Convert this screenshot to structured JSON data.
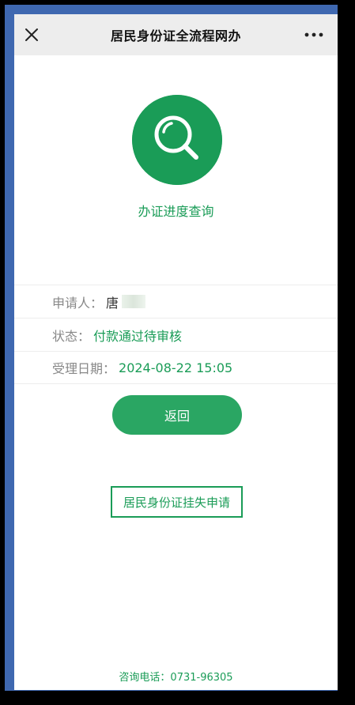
{
  "window": {
    "title": "居民身份证全流程网办"
  },
  "hero": {
    "label": "办证进度查询",
    "icon": "search-icon"
  },
  "info": {
    "applicant_key": "申请人：",
    "applicant_value": "唐",
    "status_key": "状态：",
    "status_value": "付款通过待审核",
    "date_key": "受理日期：",
    "date_value": "2024-08-22 15:05"
  },
  "buttons": {
    "back_label": "返回",
    "loss_label": "居民身份证挂失申请"
  },
  "footer": {
    "hotline": "咨询电话：0731-96305"
  },
  "colors": {
    "accent": "#1a9c57",
    "button": "#2aa663",
    "frame": "#3f68b0"
  }
}
